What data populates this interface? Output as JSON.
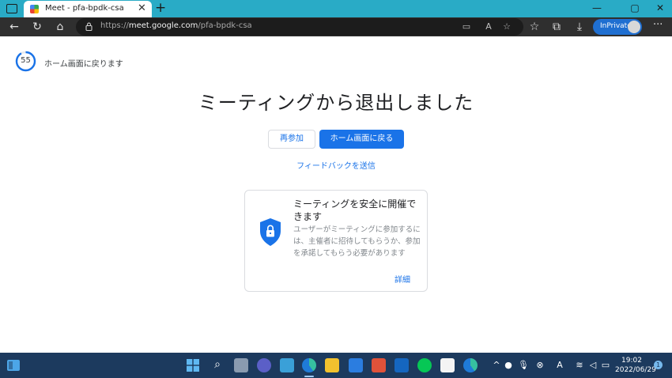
{
  "browser": {
    "tab": {
      "title": "Meet - pfa-bpdk-csa",
      "close": "✕"
    },
    "new_tab": "+",
    "window_controls": {
      "minimize": "—",
      "maximize": "▢",
      "close": "✕"
    },
    "nav": {
      "back": "←",
      "reload": "↻",
      "home": "⌂",
      "more": "···"
    },
    "url": {
      "prefix": "https://",
      "host": "meet.google.com",
      "path": "/pfa-bpdk-csa"
    },
    "inprivate_label": "InPrivate"
  },
  "page": {
    "countdown": "55",
    "return_text": "ホーム画面に戻ります",
    "headline": "ミーティングから退出しました",
    "rejoin_label": "再参加",
    "home_label": "ホーム画面に戻る",
    "feedback_label": "フィードバックを送信",
    "card": {
      "title": "ミーティングを安全に開催できます",
      "body": "ユーザーがミーティングに参加するには、主催者に招待してもらうか、参加を承諾してもらう必要があります",
      "link": "詳細"
    },
    "colors": {
      "primary": "#1a73e8",
      "progress": "#1a73e8"
    }
  },
  "taskbar": {
    "time": "19:02",
    "date": "2022/06/29",
    "notification_count": "1"
  }
}
